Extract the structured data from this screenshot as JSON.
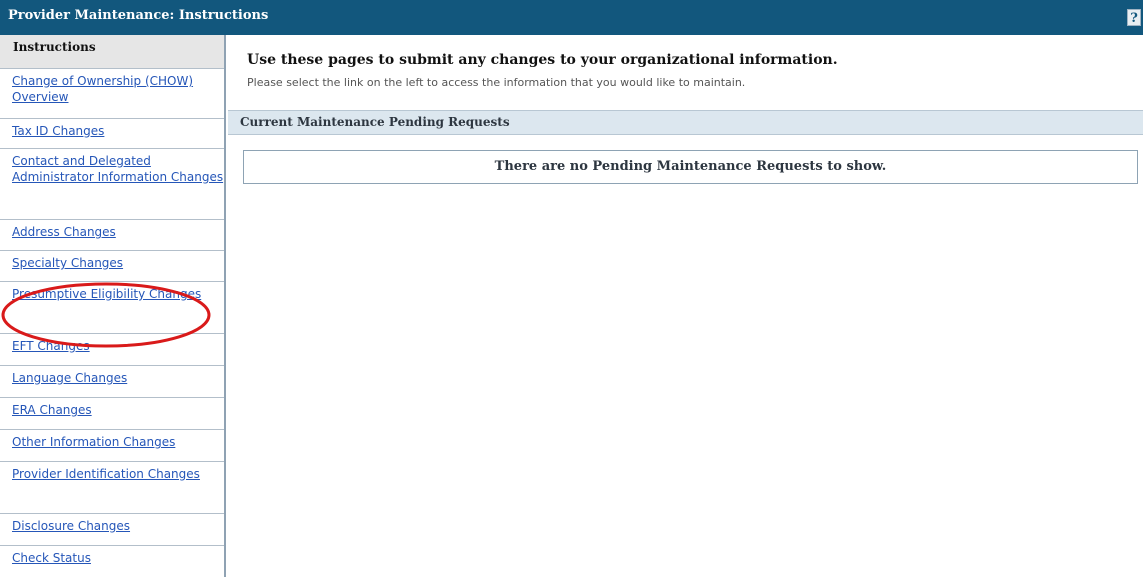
{
  "window": {
    "title": "Provider Maintenance: Instructions",
    "help_label": "?"
  },
  "sidebar": {
    "active_label": "Instructions",
    "items": [
      {
        "label": "Change of Ownership (CHOW) Overview"
      },
      {
        "label": "Tax ID Changes"
      },
      {
        "label": "Contact and Delegated Administrator Information Changes"
      },
      {
        "label": "Address Changes"
      },
      {
        "label": "Specialty Changes"
      },
      {
        "label": "Presumptive Eligibility Changes"
      },
      {
        "label": "EFT Changes"
      },
      {
        "label": "Language Changes"
      },
      {
        "label": "ERA Changes"
      },
      {
        "label": "Other Information Changes"
      },
      {
        "label": "Provider Identification Changes"
      },
      {
        "label": "Disclosure Changes"
      },
      {
        "label": "Check Status"
      }
    ]
  },
  "main": {
    "heading": "Use these pages to submit any changes to your organizational information.",
    "subtext": "Please select the link on the left to access the information that you would like to maintain.",
    "section_title": "Current Maintenance Pending Requests",
    "empty_message": "There are no Pending Maintenance Requests to show."
  },
  "annotation": {
    "color": "#d91a1a"
  }
}
